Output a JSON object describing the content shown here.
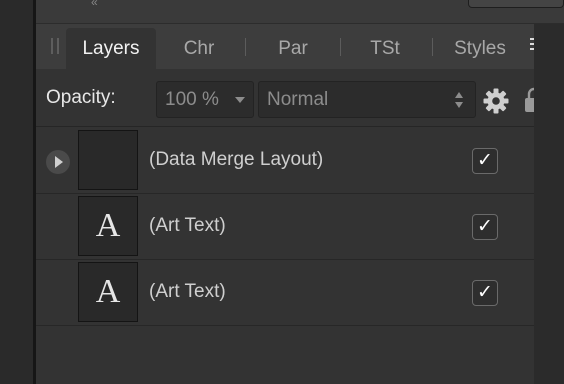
{
  "tabs": [
    {
      "label": "Layers",
      "active": true
    },
    {
      "label": "Chr",
      "active": false
    },
    {
      "label": "Par",
      "active": false
    },
    {
      "label": "TSt",
      "active": false
    },
    {
      "label": "Styles",
      "active": false
    }
  ],
  "opacity": {
    "label": "Opacity:",
    "value": "100 %"
  },
  "blend_mode": {
    "value": "Normal"
  },
  "icons": {
    "grip": "grip-icon",
    "panel_menu": "hamburger-menu-icon",
    "gear": "gear-icon",
    "lock": "lock-icon",
    "expand": "triangle-right-icon"
  },
  "layers": [
    {
      "name": "(Data Merge Layout)",
      "thumb_glyph": "",
      "has_children": true,
      "visible": true
    },
    {
      "name": "(Art Text)",
      "thumb_glyph": "A",
      "has_children": false,
      "visible": true
    },
    {
      "name": "(Art Text)",
      "thumb_glyph": "A",
      "has_children": false,
      "visible": true
    }
  ],
  "checkmark": "✓",
  "colors": {
    "panel_bg": "#333333",
    "tab_bar_bg": "#3d3d3d",
    "active_tab_text": "#f2f2f2",
    "inactive_tab_text": "#a8a8a8"
  }
}
